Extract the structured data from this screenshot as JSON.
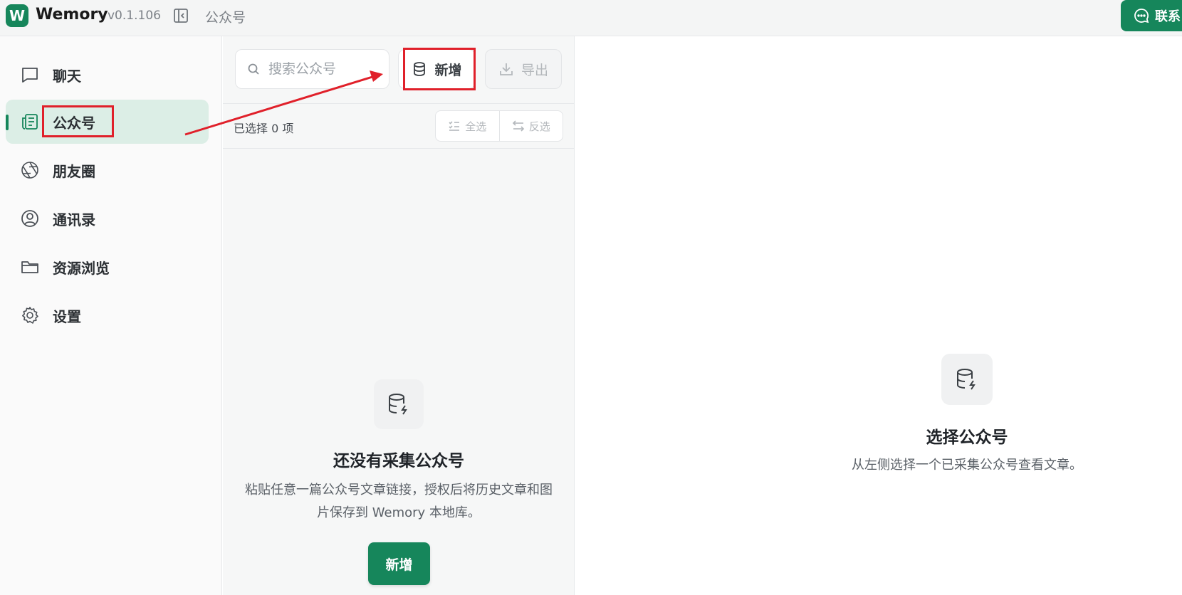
{
  "app": {
    "logo_letter": "W",
    "name": "Wemory",
    "version": "v0.1.106",
    "breadcrumb": "公众号",
    "contact_label": "联系",
    "brand_color": "#16865b"
  },
  "sidebar": {
    "items": [
      {
        "label": "聊天",
        "icon": "chat-bubble-icon"
      },
      {
        "label": "公众号",
        "icon": "newspaper-icon",
        "active": true
      },
      {
        "label": "朋友圈",
        "icon": "aperture-icon"
      },
      {
        "label": "通讯录",
        "icon": "user-circle-icon"
      },
      {
        "label": "资源浏览",
        "icon": "folder-icon"
      },
      {
        "label": "设置",
        "icon": "gear-icon"
      }
    ]
  },
  "list": {
    "search_placeholder": "搜索公众号",
    "add_label": "新增",
    "export_label": "导出",
    "selected_text": "已选择 0 项",
    "select_all_label": "全选",
    "invert_label": "反选",
    "empty_title": "还没有采集公众号",
    "empty_desc": "粘贴任意一篇公众号文章链接，授权后将历史文章和图片保存到 Wemory 本地库。",
    "empty_add_label": "新增"
  },
  "detail": {
    "title": "选择公众号",
    "desc": "从左侧选择一个已采集公众号查看文章。"
  },
  "annotation_color": "#e0202a"
}
